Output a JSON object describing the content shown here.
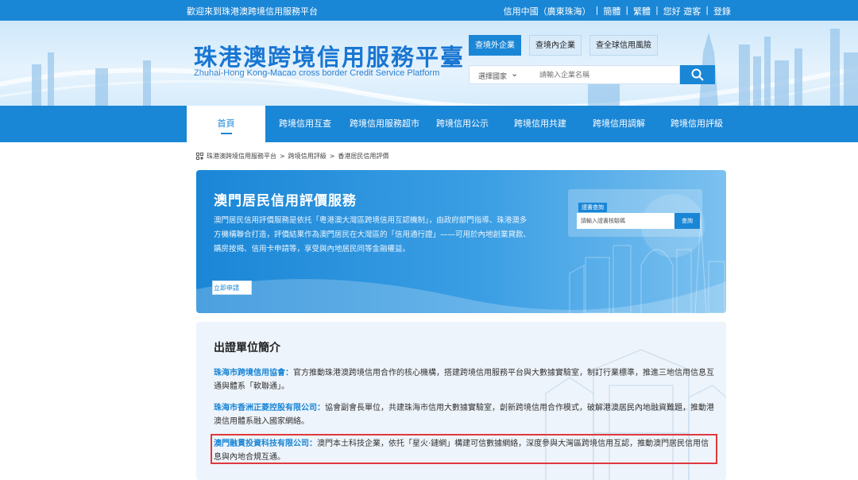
{
  "topbar": {
    "welcome": "歡迎來到珠港澳跨境信用服務平台",
    "links": [
      "信用中國（廣東珠海）",
      "|",
      "簡體",
      "|",
      "繁體",
      "|",
      "您好 遊客",
      "|",
      "登錄"
    ]
  },
  "header": {
    "title_cn": "珠港澳跨境信用服務平臺",
    "title_en": "Zhuhai-Hong Kong-Macao cross border Credit Service Platform",
    "tabs": [
      "查境外企業",
      "查境內企業",
      "查全球信用風險"
    ],
    "search": {
      "select": "選擇國家",
      "placeholder": "請輸入企業名稱"
    }
  },
  "nav": {
    "home": "首頁",
    "items": [
      "跨境信用互查",
      "跨境信用服務超市",
      "跨境信用公示",
      "跨境信用共建",
      "跨境信用調解",
      "跨境信用評級"
    ]
  },
  "breadcrumb": {
    "items": [
      "珠港澳跨境信用服務平台",
      ">",
      "跨境信用評級",
      ">",
      "香港居民信用評價"
    ]
  },
  "service": {
    "title": "澳門居民信用評價服務",
    "desc": "澳門居民信用評價服務是依托「粵港澳大灣區跨境信用互認機制」，由政府部門指導、珠港澳多方機構聯合打造，評價結果作為澳門居民在大灣區的「信用通行證」——可用於內地創業貸款、購房按揭、信用卡申請等，享受與內地居民同等金融權益。",
    "apply": "立即申請",
    "verify": {
      "label": "證書查詢",
      "placeholder": "請輸入證書核驗碼",
      "button": "查詢"
    }
  },
  "intro": {
    "title": "出證單位簡介",
    "paras": [
      {
        "org": "珠海市跨境信用協會：",
        "text": "官方推動珠港澳跨境信用合作的核心機構，搭建跨境信用服務平台與大數據實驗室，制訂行業標準，推進三地信用信息互通與體系「軟聯通」。"
      },
      {
        "org": "珠海市香洲正菱控股有限公司：",
        "text": "協會副會長單位，共建珠海市信用大數據實驗室，創新跨境信用合作模式，破解港澳居民內地融資難題，推動港澳信用體系融入國家網絡。"
      },
      {
        "org": "澳門融貫投資科技有限公司：",
        "text": "澳門本土科技企業，依托「星火·鏈網」構建可信數據網絡，深度參與大灣區跨境信用互認，推動澳門居民信用信息與內地合規互通。"
      }
    ]
  },
  "colors": {
    "primary": "#1a86d6",
    "highlight": "#e0393e"
  }
}
